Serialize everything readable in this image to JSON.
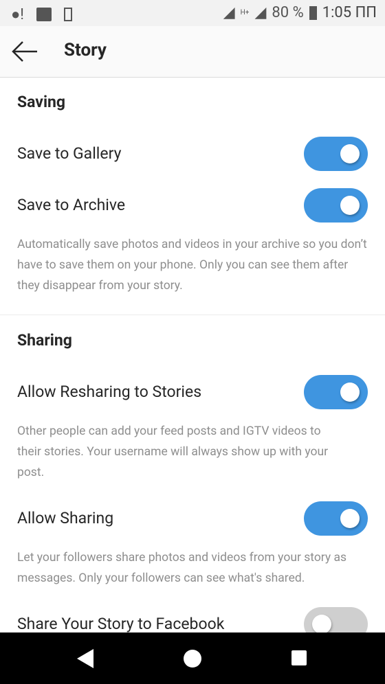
{
  "status_bar": {
    "battery": "80 %",
    "time": "1:05 ПП",
    "network": "H+",
    "icons": [
      "record-icon",
      "image-icon",
      "phone-card-icon",
      "signal-icon",
      "battery-icon"
    ]
  },
  "header": {
    "title": "Story",
    "back_icon": "arrow-left-icon"
  },
  "accent": "#3f95e0",
  "sections": [
    {
      "title": "Saving",
      "items": [
        {
          "label": "Save to Gallery",
          "on": true
        },
        {
          "label": "Save to Archive",
          "on": true,
          "description": "Automatically save photos and videos in your archive so you don’t have to save them on your phone. Only you can see them after they disappear from your story."
        }
      ]
    },
    {
      "title": "Sharing",
      "items": [
        {
          "label": "Allow Resharing to Stories",
          "on": true,
          "description": "Other people can add your feed posts and IGTV videos to their stories. Your username will always show up with your post."
        },
        {
          "label": "Allow Sharing",
          "on": true,
          "description": "Let your followers share photos and videos from your story as messages. Only your followers can see what's shared."
        },
        {
          "label": "Share Your Story to Facebook",
          "on": false
        }
      ]
    }
  ]
}
